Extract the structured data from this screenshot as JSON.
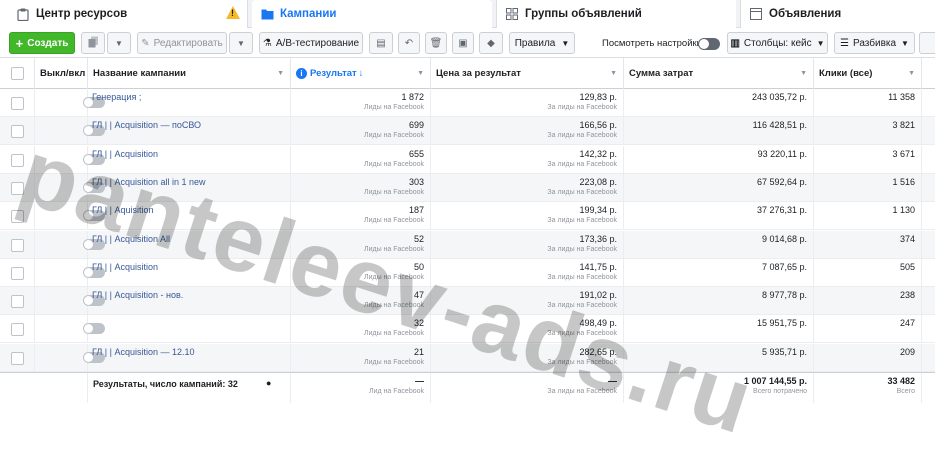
{
  "tabs": [
    {
      "label": "Центр ресурсов",
      "icon": "clipboard-icon"
    },
    {
      "label": "Кампании",
      "icon": "folder-icon"
    },
    {
      "label": "Группы объявлений",
      "icon": "grid-icon"
    },
    {
      "label": "Объявления",
      "icon": "ad-icon"
    }
  ],
  "toolbar": {
    "create": "Создать",
    "edit": "Редактировать",
    "ab": "A/B-тестирование",
    "rules": "Правила",
    "view_settings": "Посмотреть настройки",
    "columns": "Столбцы: кейс",
    "breakdown": "Разбивка"
  },
  "columns": [
    "Выкл/вкл",
    "Название кампании",
    "Результат",
    "Цена за результат",
    "Сумма затрат",
    "Клики (все)"
  ],
  "rows": [
    {
      "name": "Генерация ;",
      "result": "1 872",
      "result_sub": "Лиды на Facebook",
      "cost": "129,83 р.",
      "cost_sub": "За лиды на Facebook",
      "spent": "243 035,72 р.",
      "clicks": "11 358"
    },
    {
      "name": "ГЛ | | Acquisition — поСВО",
      "result": "699",
      "result_sub": "Лиды на Facebook",
      "cost": "166,56 р.",
      "cost_sub": "За лиды на Facebook",
      "spent": "116 428,51 р.",
      "clicks": "3 821"
    },
    {
      "name": "ГЛ | | Acquisition",
      "result": "655",
      "result_sub": "Лиды на Facebook",
      "cost": "142,32 р.",
      "cost_sub": "За лиды на Facebook",
      "spent": "93 220,11 р.",
      "clicks": "3 671"
    },
    {
      "name": "ГЛ | | Acquisition all in 1 new",
      "result": "303",
      "result_sub": "Лиды на Facebook",
      "cost": "223,08 р.",
      "cost_sub": "За лиды на Facebook",
      "spent": "67 592,64 р.",
      "clicks": "1 516"
    },
    {
      "name": "ГЛ | | Aquisition",
      "result": "187",
      "result_sub": "Лиды на Facebook",
      "cost": "199,34 р.",
      "cost_sub": "За лиды на Facebook",
      "spent": "37 276,31 р.",
      "clicks": "1 130"
    },
    {
      "name": "ГЛ | | Acquisition All",
      "result": "52",
      "result_sub": "Лиды на Facebook",
      "cost": "173,36 р.",
      "cost_sub": "За лиды на Facebook",
      "spent": "9 014,68 р.",
      "clicks": "374"
    },
    {
      "name": "ГЛ | | Acquisition",
      "result": "50",
      "result_sub": "Лиды на Facebook",
      "cost": "141,75 р.",
      "cost_sub": "За лиды на Facebook",
      "spent": "7 087,65 р.",
      "clicks": "505"
    },
    {
      "name": "ГЛ | | Acquisition - нов.",
      "result": "47",
      "result_sub": "Лиды на Facebook",
      "cost": "191,02 р.",
      "cost_sub": "За лиды на Facebook",
      "spent": "8 977,78 р.",
      "clicks": "238"
    },
    {
      "name": "",
      "result": "32",
      "result_sub": "Лиды на Facebook",
      "cost": "498,49 р.",
      "cost_sub": "За лиды на Facebook",
      "spent": "15 951,75 р.",
      "clicks": "247"
    },
    {
      "name": "ГЛ | | Acquisition — 12.10",
      "result": "21",
      "result_sub": "Лиды на Facebook",
      "cost": "282,65 р.",
      "cost_sub": "За лиды на Facebook",
      "spent": "5 935,71 р.",
      "clicks": "209"
    }
  ],
  "totals": {
    "label": "Результаты, число кампаний: 32",
    "result": "—",
    "result_sub": "Лид на Facebook",
    "cost": "—",
    "cost_sub": "За лиды на Facebook",
    "spent": "1 007 144,55 р.",
    "spent_sub": "Всего потрачено",
    "clicks": "33 482",
    "clicks_sub": "Всего"
  },
  "watermark": "panteleev-ads.ru"
}
